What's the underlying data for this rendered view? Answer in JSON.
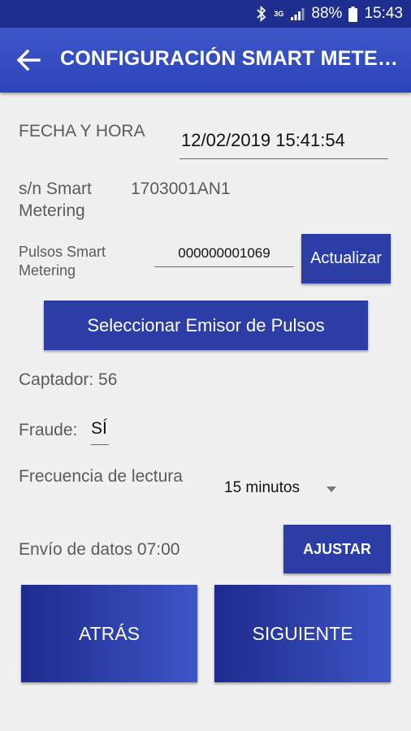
{
  "statusbar": {
    "network": "3G",
    "battery": "88%",
    "time": "15:43"
  },
  "appbar": {
    "title": "CONFIGURACIÓN SMART METERING"
  },
  "datetime": {
    "label": "FECHA Y HORA",
    "value": "12/02/2019 15:41:54"
  },
  "serial": {
    "label_line1": "s/n Smart",
    "label_line2": "Metering",
    "value": "1703001AN1"
  },
  "pulses": {
    "label_line1": "Pulsos Smart",
    "label_line2": "Metering",
    "value": "000000001069",
    "update_label": "Actualizar"
  },
  "select_emitter_label": "Seleccionar Emisor de Pulsos",
  "captador": {
    "text": "Captador: 56"
  },
  "fraude": {
    "label": "Fraude:",
    "value": "SÍ"
  },
  "frequency": {
    "label": "Frecuencia de lectura",
    "selected": "15 minutos"
  },
  "send": {
    "text": "Envío de datos 07:00",
    "adjust_label": "AJUSTAR"
  },
  "nav": {
    "back_label": "ATRÁS",
    "next_label": "SIGUIENTE"
  }
}
